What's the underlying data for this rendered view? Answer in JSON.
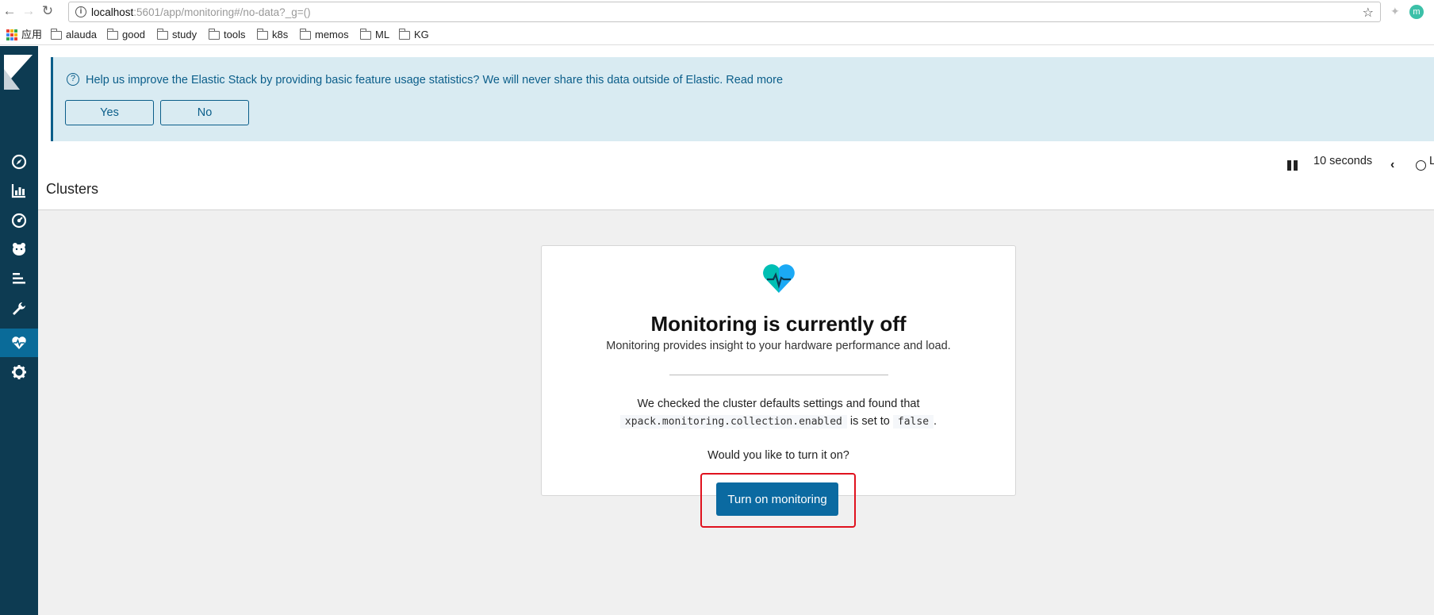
{
  "browser": {
    "url_host": "localhost",
    "url_rest": ":5601/app/monitoring#/no-data?_g=()",
    "bookmarks": [
      {
        "label": "应用",
        "type": "apps"
      },
      {
        "label": "alauda",
        "type": "folder"
      },
      {
        "label": "good",
        "type": "folder"
      },
      {
        "label": "study",
        "type": "folder"
      },
      {
        "label": "tools",
        "type": "folder"
      },
      {
        "label": "k8s",
        "type": "folder"
      },
      {
        "label": "memos",
        "type": "folder"
      },
      {
        "label": "ML",
        "type": "folder"
      },
      {
        "label": "KG",
        "type": "folder"
      }
    ],
    "profile_initial": "m"
  },
  "sidebar": {
    "items": [
      {
        "name": "discover-icon"
      },
      {
        "name": "visualize-icon"
      },
      {
        "name": "dashboard-icon"
      },
      {
        "name": "timelion-icon"
      },
      {
        "name": "apm-icon"
      },
      {
        "name": "dev-tools-icon"
      },
      {
        "name": "monitoring-icon",
        "active": true
      },
      {
        "name": "management-icon"
      }
    ]
  },
  "banner": {
    "text": "Help us improve the Elastic Stack by providing basic feature usage statistics? We will never share this data outside of Elastic. Read more",
    "yes_label": "Yes",
    "no_label": "No"
  },
  "toolbar": {
    "refresh_interval": "10 seconds",
    "time_label": "L"
  },
  "page": {
    "title": "Clusters"
  },
  "card": {
    "title": "Monitoring is currently off",
    "subtitle": "Monitoring provides insight to your hardware performance and load.",
    "para_prefix": "We checked the cluster defaults settings and found that",
    "setting_name": "xpack.monitoring.collection.enabled",
    "para_middle": "is set to",
    "setting_value": "false",
    "para_suffix": ".",
    "question": "Would you like to turn it on?",
    "button_label": "Turn on monitoring"
  },
  "colors": {
    "sidebar_bg": "#0d3b52",
    "sidebar_active": "#0a6b99",
    "banner_bg": "#d9ebf2",
    "primary": "#0b6aa1",
    "highlight": "#e0121e"
  }
}
